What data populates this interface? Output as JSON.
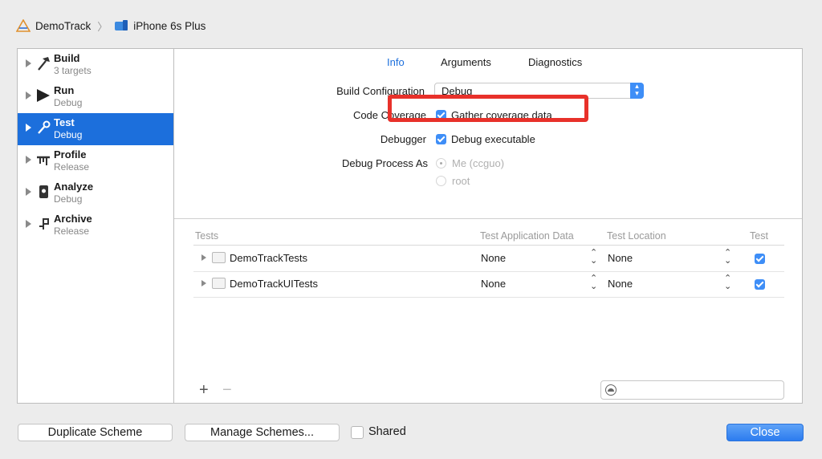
{
  "breadcrumb": {
    "project": "DemoTrack",
    "device": "iPhone 6s Plus"
  },
  "sidebar": {
    "items": [
      {
        "title": "Build",
        "subtitle": "3 targets",
        "icon": "hammer-icon"
      },
      {
        "title": "Run",
        "subtitle": "Debug",
        "icon": "play-icon"
      },
      {
        "title": "Test",
        "subtitle": "Debug",
        "icon": "wrench-icon",
        "selected": true
      },
      {
        "title": "Profile",
        "subtitle": "Release",
        "icon": "gauge-icon"
      },
      {
        "title": "Analyze",
        "subtitle": "Debug",
        "icon": "analyze-icon"
      },
      {
        "title": "Archive",
        "subtitle": "Release",
        "icon": "archive-icon"
      }
    ]
  },
  "tabs": {
    "info": "Info",
    "arguments": "Arguments",
    "diagnostics": "Diagnostics",
    "active": "Info"
  },
  "settings": {
    "build_configuration_label": "Build Configuration",
    "build_configuration_value": "Debug",
    "code_coverage_label": "Code Coverage",
    "code_coverage_option": "Gather coverage data",
    "debugger_label": "Debugger",
    "debugger_option": "Debug executable",
    "debug_process_as_label": "Debug Process As",
    "debug_process_me": "Me (ccguo)",
    "debug_process_root": "root"
  },
  "tests_table": {
    "headers": [
      "Tests",
      "Test Application Data",
      "Test Location",
      "Test"
    ],
    "rows": [
      {
        "name": "DemoTrackTests",
        "app_data": "None",
        "location": "None",
        "enabled": true
      },
      {
        "name": "DemoTrackUITests",
        "app_data": "None",
        "location": "None",
        "enabled": true
      }
    ],
    "add_label": "+",
    "remove_label": "−"
  },
  "buttons": {
    "duplicate": "Duplicate Scheme",
    "manage": "Manage Schemes...",
    "shared": "Shared",
    "close": "Close"
  },
  "colors": {
    "accent": "#1c6fdc",
    "highlight": "#e8312a"
  }
}
